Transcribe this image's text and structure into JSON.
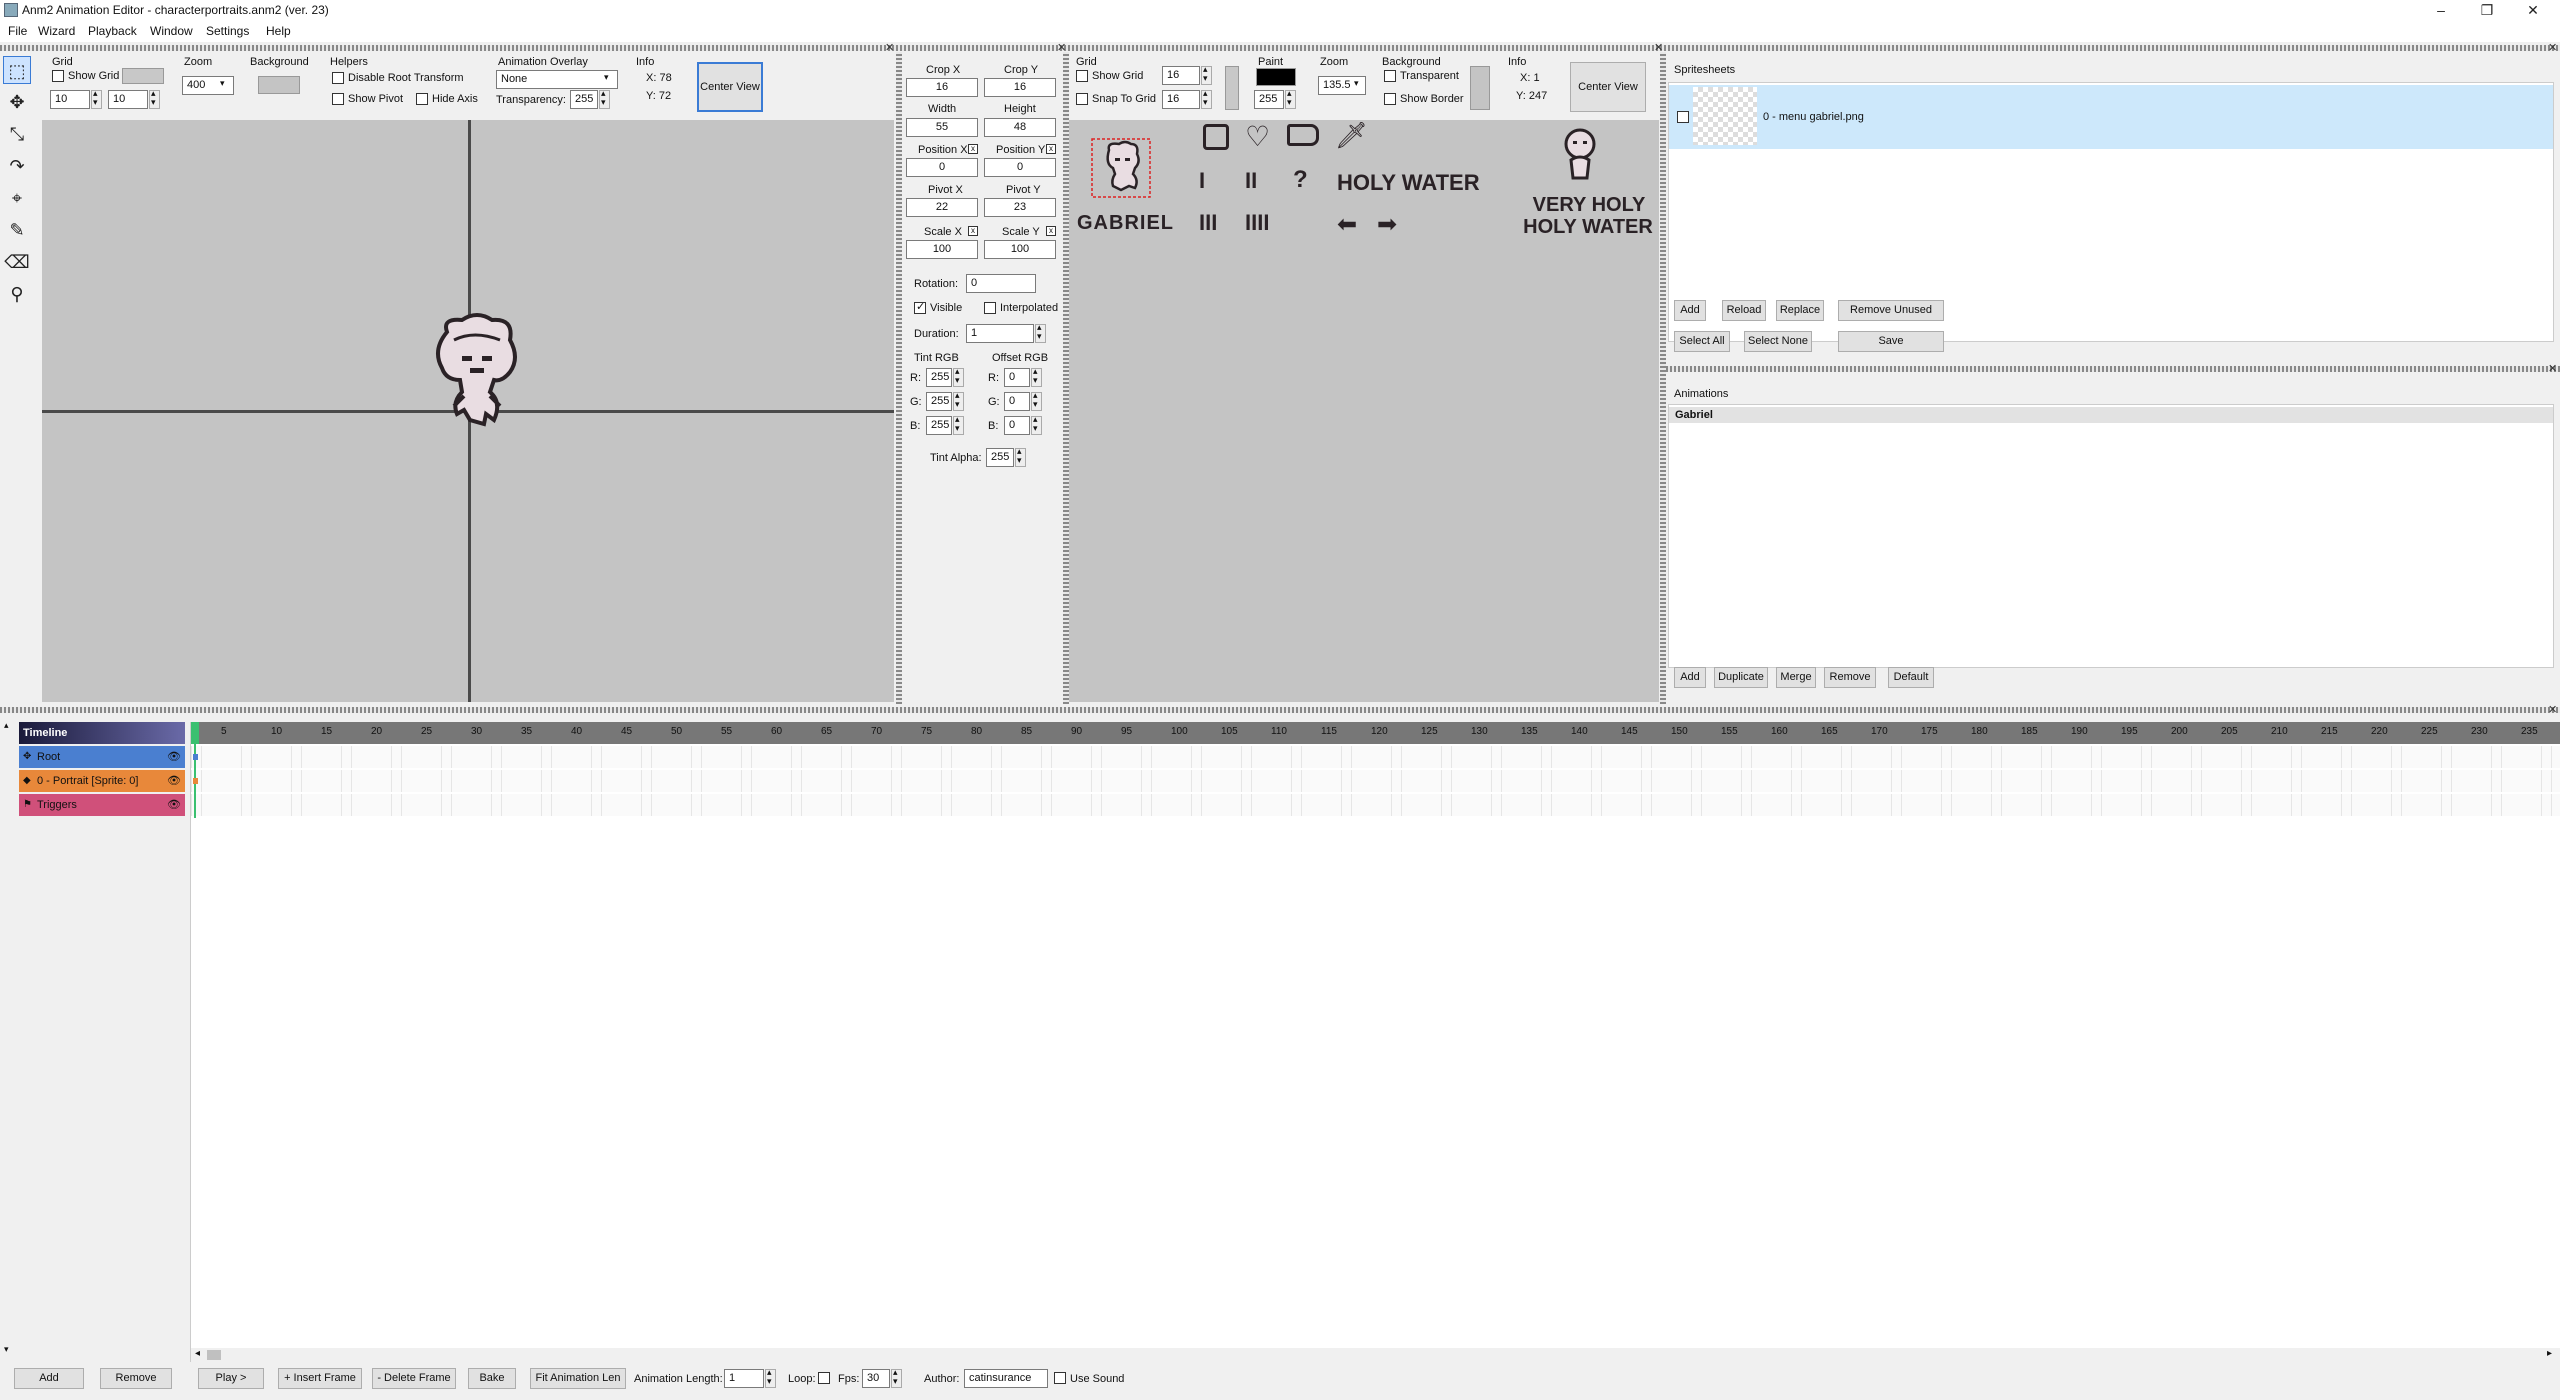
{
  "window": {
    "title": "Anm2 Animation Editor - characterportraits.anm2 (ver. 23)",
    "minimize": "–",
    "maximize": "❐",
    "close": "✕"
  },
  "menu": [
    "File",
    "Wizard",
    "Playback",
    "Window",
    "Settings",
    "Help"
  ],
  "preview_toolbar": {
    "grid_label": "Grid",
    "show_grid": "Show Grid",
    "grid_w": "10",
    "grid_h": "10",
    "zoom_label": "Zoom",
    "zoom_value": "400",
    "background_label": "Background",
    "helpers_label": "Helpers",
    "disable_root_transform": "Disable Root Transform",
    "show_pivot": "Show Pivot",
    "hide_axis": "Hide Axis",
    "overlay_label": "Animation Overlay",
    "overlay_value": "None",
    "transparency_label": "Transparency:",
    "transparency_value": "255",
    "info_label": "Info",
    "info_x": "X: 78",
    "info_y": "Y: 72",
    "center_view": "Center View"
  },
  "frame_props": {
    "crop_x_label": "Crop X",
    "crop_x": "16",
    "crop_y_label": "Crop Y",
    "crop_y": "16",
    "width_label": "Width",
    "width": "55",
    "height_label": "Height",
    "height": "48",
    "pos_x_label": "Position X",
    "pos_x": "0",
    "pos_y_label": "Position Y",
    "pos_y": "0",
    "pivot_x_label": "Pivot X",
    "pivot_x": "22",
    "pivot_y_label": "Pivot Y",
    "pivot_y": "23",
    "scale_x_label": "Scale X",
    "scale_x": "100",
    "scale_y_label": "Scale Y",
    "scale_y": "100",
    "rotation_label": "Rotation:",
    "rotation": "0",
    "visible": "Visible",
    "interpolated": "Interpolated",
    "duration_label": "Duration:",
    "duration": "1",
    "tint_label": "Tint RGB",
    "offset_label": "Offset RGB",
    "r": "R:",
    "g": "G:",
    "b": "B:",
    "tint_r": "255",
    "tint_g": "255",
    "tint_b": "255",
    "off_r": "0",
    "off_g": "0",
    "off_b": "0",
    "tint_alpha_label": "Tint Alpha:",
    "tint_alpha": "255",
    "x_mark": "x"
  },
  "spritesheet_toolbar": {
    "grid_label": "Grid",
    "show_grid": "Show Grid",
    "grid_w": "16",
    "snap_to_grid": "Snap To Grid",
    "grid_h": "16",
    "paint_label": "Paint",
    "paint_value": "255",
    "zoom_label": "Zoom",
    "zoom_value": "135.5",
    "background_label": "Background",
    "transparent": "Transparent",
    "show_border": "Show Border",
    "info_label": "Info",
    "info_x": "X: 1",
    "info_y": "Y: 247",
    "center_view": "Center View"
  },
  "sheet_art": {
    "gabriel": "GABRIEL",
    "holy_water": "HOLY WATER",
    "very_holy": "VERY HOLY",
    "holy_water2": "HOLY WATER",
    "tally1": "I",
    "tally2": "II",
    "tally3": "III",
    "tally4": "IIII",
    "question": "?",
    "left_arrow": "⬅",
    "right_arrow": "➡"
  },
  "spritesheets": {
    "title": "Spritesheets",
    "item": "0 - menu gabriel.png",
    "add": "Add",
    "reload": "Reload",
    "replace": "Replace",
    "remove_unused": "Remove Unused",
    "select_all": "Select All",
    "select_none": "Select None",
    "save": "Save"
  },
  "animations": {
    "title": "Animations",
    "item": "Gabriel",
    "add": "Add",
    "duplicate": "Duplicate",
    "merge": "Merge",
    "remove": "Remove",
    "default": "Default"
  },
  "timeline": {
    "title": "Timeline",
    "layers": [
      "Root",
      "0 - Portrait [Sprite: 0]",
      "Triggers"
    ],
    "ticks": [
      "5",
      "10",
      "15",
      "20",
      "25",
      "30",
      "35",
      "40",
      "45",
      "50",
      "55",
      "60",
      "65",
      "70",
      "75",
      "80",
      "85",
      "90",
      "95",
      "100",
      "105",
      "110",
      "115",
      "120",
      "125",
      "130",
      "135",
      "140",
      "145",
      "150",
      "155",
      "160",
      "165",
      "170",
      "175",
      "180",
      "185",
      "190",
      "195",
      "200",
      "205",
      "210",
      "215",
      "220",
      "225",
      "230",
      "235"
    ],
    "add": "Add",
    "remove": "Remove",
    "play": "Play >",
    "insert_frame": "+ Insert Frame",
    "delete_frame": "- Delete Frame",
    "bake": "Bake",
    "fit_len": "Fit Animation Len",
    "anim_length_label": "Animation Length:",
    "anim_length": "1",
    "loop_label": "Loop:",
    "fps_label": "Fps:",
    "fps": "30",
    "author_label": "Author:",
    "author": "catinsurance",
    "use_sound": "Use Sound"
  },
  "colors": {
    "root": "#4a7fd0",
    "layer": "#e8883a",
    "triggers": "#d0507a",
    "selected": "#cde8fb"
  }
}
